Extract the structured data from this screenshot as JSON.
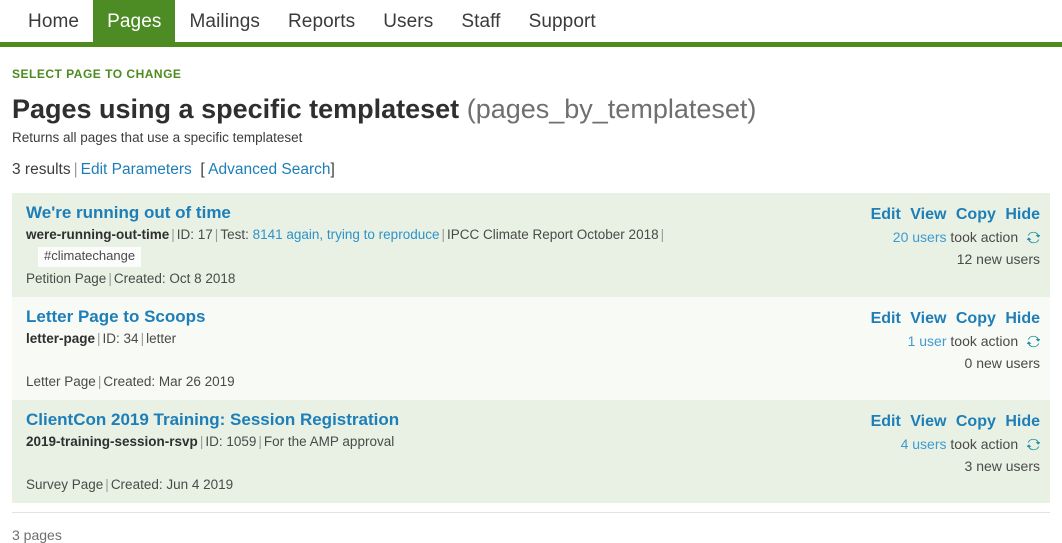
{
  "nav": {
    "items": [
      {
        "label": "Home",
        "active": false
      },
      {
        "label": "Pages",
        "active": true
      },
      {
        "label": "Mailings",
        "active": false
      },
      {
        "label": "Reports",
        "active": false
      },
      {
        "label": "Users",
        "active": false
      },
      {
        "label": "Staff",
        "active": false
      },
      {
        "label": "Support",
        "active": false
      }
    ],
    "accent_color": "#4d8b1f",
    "active_tab_color": "#4d8b25"
  },
  "header": {
    "breadcrumb": "SELECT PAGE TO CHANGE",
    "title": "Pages using a specific templateset",
    "title_slug": "(pages_by_templateset)",
    "subtitle": "Returns all pages that use a specific templateset"
  },
  "results_bar": {
    "count_text": "3 results",
    "separator": "|",
    "edit_parameters_label": "Edit Parameters",
    "bracket_open": "[",
    "advanced_search_label": "Advanced Search",
    "bracket_close": "]"
  },
  "actions": {
    "edit_label": "Edit",
    "view_label": "View",
    "copy_label": "Copy",
    "hide_label": "Hide",
    "refresh_icon": "refresh-icon",
    "refresh_icon_color": "#1d8f9e"
  },
  "results": [
    {
      "title": "We're running out of time",
      "slug": "were-running-out-time",
      "id_label": "ID: 17",
      "test_label": "Test:",
      "test_link": "8141 again, trying to reproduce",
      "note": "IPCC Climate Report October 2018",
      "trailing_pipe": "|",
      "tag": "#climatechange",
      "page_type": "Petition Page",
      "created": "Created: Oct 8 2018",
      "took_action_count": "20 users",
      "took_action_label": "took action",
      "new_users": "12 new users"
    },
    {
      "title": "Letter Page to Scoops",
      "slug": "letter-page",
      "id_label": "ID: 34",
      "note": "letter",
      "tag": "",
      "page_type": "Letter Page",
      "created": "Created: Mar 26 2019",
      "took_action_count": "1 user",
      "took_action_label": "took action",
      "new_users": "0 new users"
    },
    {
      "title": "ClientCon 2019 Training: Session Registration",
      "slug": "2019-training-session-rsvp",
      "id_label": "ID: 1059",
      "note": "For the AMP approval",
      "tag": "",
      "page_type": "Survey Page",
      "created": "Created: Jun 4 2019",
      "took_action_count": "4 users",
      "took_action_label": "took action",
      "new_users": "3 new users"
    }
  ],
  "footer": {
    "total_label": "3 pages"
  }
}
